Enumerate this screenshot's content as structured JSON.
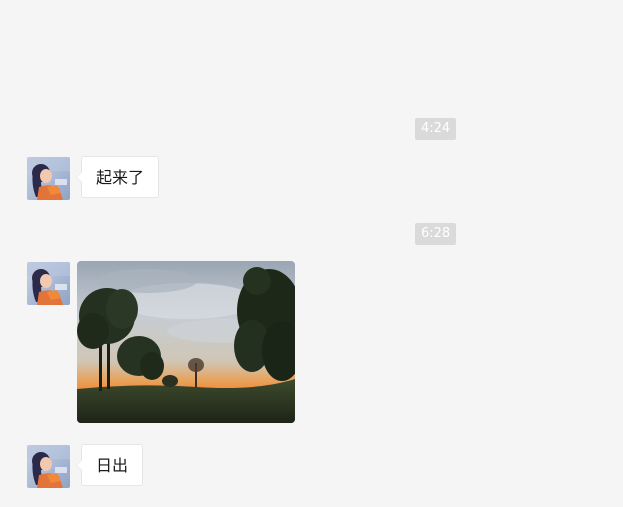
{
  "messages": [
    {
      "type": "timestamp",
      "text": "4:24"
    },
    {
      "type": "text",
      "sender": "avatar",
      "text": "起来了"
    },
    {
      "type": "timestamp",
      "text": "6:28"
    },
    {
      "type": "image",
      "sender": "avatar",
      "image_desc": "sunset-photo"
    },
    {
      "type": "text",
      "sender": "avatar",
      "text": "日出"
    }
  ],
  "colors": {
    "background": "#f5f5f5",
    "timestamp_bg": "#dadada",
    "timestamp_text": "#ffffff",
    "bubble_bg": "#ffffff",
    "bubble_text": "#1a1a1a"
  }
}
